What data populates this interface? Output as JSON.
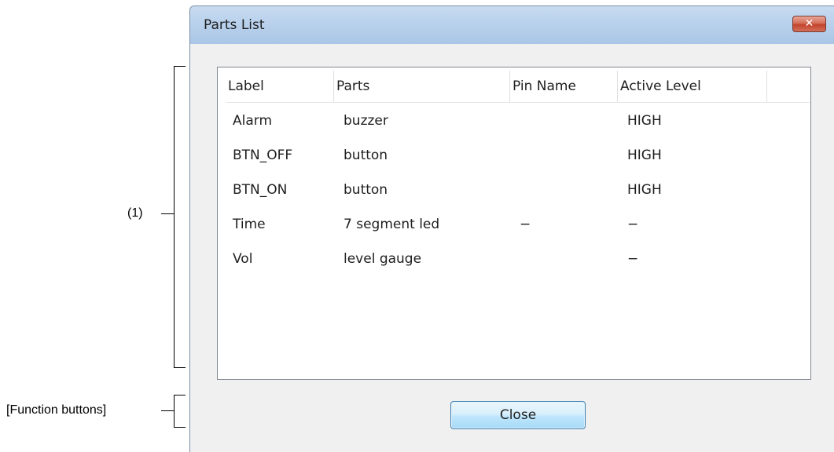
{
  "annotations": {
    "list_callout": "(1)",
    "buttons_callout": "[Function buttons]"
  },
  "dialog": {
    "title": "Parts List",
    "close_icon_glyph": "✕",
    "columns": [
      "Label",
      "Parts",
      "Pin Name",
      "Active Level"
    ],
    "rows": [
      {
        "label": "Alarm",
        "parts": "buzzer",
        "pin": "",
        "level": "HIGH"
      },
      {
        "label": "BTN_OFF",
        "parts": "button",
        "pin": "",
        "level": "HIGH"
      },
      {
        "label": "BTN_ON",
        "parts": "button",
        "pin": "",
        "level": "HIGH"
      },
      {
        "label": "Time",
        "parts": "7 segment led",
        "pin": "−",
        "level": "−"
      },
      {
        "label": "Vol",
        "parts": "level gauge",
        "pin": "",
        "level": "−"
      }
    ],
    "close_button_label": "Close"
  },
  "colors": {
    "titlebar": "#b9d1ec",
    "close_x": "#c2432c",
    "button_border": "#3c7fb1",
    "client_bg": "#f0f0f0"
  }
}
